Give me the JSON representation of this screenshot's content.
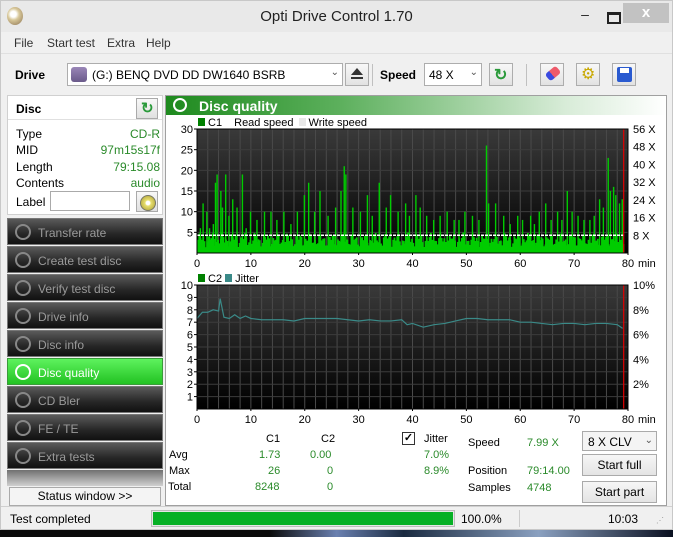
{
  "window": {
    "title": "Opti Drive Control 1.70",
    "minimize": "–",
    "close": "x"
  },
  "menu": [
    "File",
    "Start test",
    "Extra",
    "Help"
  ],
  "toolbar": {
    "drive_label": "Drive",
    "drive_value": "(G:)   BENQ DVD DD DW1640 BSRB",
    "speed_label": "Speed",
    "speed_value": "48 X"
  },
  "disc": {
    "title": "Disc",
    "fields": [
      {
        "key": "Type",
        "value": "CD-R"
      },
      {
        "key": "MID",
        "value": "97m15s17f"
      },
      {
        "key": "Length",
        "value": "79:15.08"
      },
      {
        "key": "Contents",
        "value": "audio"
      }
    ],
    "label_key": "Label",
    "label_value": ""
  },
  "nav": [
    {
      "label": "Transfer rate",
      "active": false
    },
    {
      "label": "Create test disc",
      "active": false
    },
    {
      "label": "Verify test disc",
      "active": false
    },
    {
      "label": "Drive info",
      "active": false
    },
    {
      "label": "Disc info",
      "active": false
    },
    {
      "label": "Disc quality",
      "active": true
    },
    {
      "label": "CD Bler",
      "active": false
    },
    {
      "label": "FE / TE",
      "active": false
    },
    {
      "label": "Extra tests",
      "active": false
    }
  ],
  "status_window_button": "Status window >>",
  "panel_title": "Disc quality",
  "chart_data": [
    {
      "type": "bar",
      "title": "C1",
      "legend": [
        {
          "name": "C1",
          "color": "#008000"
        },
        {
          "name": "Read speed",
          "color": "#ffffff"
        },
        {
          "name": "Write speed",
          "color": "#e8e8e8"
        }
      ],
      "xlabel": "min",
      "x_ticks": [
        0,
        10,
        20,
        30,
        40,
        50,
        60,
        70,
        80
      ],
      "xlim": [
        0,
        80
      ],
      "y_ticks": [
        5,
        10,
        15,
        20,
        25,
        30
      ],
      "ylim": [
        0,
        30
      ],
      "y2_ticks": [
        "8 X",
        "16 X",
        "24 X",
        "32 X",
        "40 X",
        "48 X",
        "56 X"
      ],
      "y2lim": [
        0,
        56
      ],
      "read_speed_x": 8,
      "end_marker_min": 79.2,
      "series_color": "#00cc00",
      "c1_peaks": [
        {
          "x": 0.5,
          "y": 6
        },
        {
          "x": 1,
          "y": 12
        },
        {
          "x": 1.7,
          "y": 10
        },
        {
          "x": 2.2,
          "y": 6
        },
        {
          "x": 2.9,
          "y": 7
        },
        {
          "x": 3.3,
          "y": 17
        },
        {
          "x": 3.6,
          "y": 19
        },
        {
          "x": 4.3,
          "y": 15
        },
        {
          "x": 4.6,
          "y": 11
        },
        {
          "x": 5.2,
          "y": 19
        },
        {
          "x": 5.8,
          "y": 9
        },
        {
          "x": 6.5,
          "y": 13
        },
        {
          "x": 7.3,
          "y": 11
        },
        {
          "x": 8.3,
          "y": 19
        },
        {
          "x": 9,
          "y": 6
        },
        {
          "x": 9.8,
          "y": 10
        },
        {
          "x": 11,
          "y": 8
        },
        {
          "x": 12.4,
          "y": 10
        },
        {
          "x": 13.6,
          "y": 10
        },
        {
          "x": 14.7,
          "y": 8
        },
        {
          "x": 16,
          "y": 10
        },
        {
          "x": 17.3,
          "y": 7
        },
        {
          "x": 18.5,
          "y": 10
        },
        {
          "x": 19.8,
          "y": 14
        },
        {
          "x": 20.6,
          "y": 17
        },
        {
          "x": 21.7,
          "y": 10
        },
        {
          "x": 22.7,
          "y": 15
        },
        {
          "x": 24.2,
          "y": 9
        },
        {
          "x": 25.6,
          "y": 11
        },
        {
          "x": 26.6,
          "y": 15
        },
        {
          "x": 27.2,
          "y": 21
        },
        {
          "x": 27.5,
          "y": 19
        },
        {
          "x": 28.8,
          "y": 11
        },
        {
          "x": 30.2,
          "y": 10
        },
        {
          "x": 31.5,
          "y": 14
        },
        {
          "x": 32.4,
          "y": 9
        },
        {
          "x": 33.7,
          "y": 17
        },
        {
          "x": 35,
          "y": 11
        },
        {
          "x": 35.8,
          "y": 14
        },
        {
          "x": 37.2,
          "y": 10
        },
        {
          "x": 38.6,
          "y": 12
        },
        {
          "x": 39.3,
          "y": 9
        },
        {
          "x": 40.5,
          "y": 14
        },
        {
          "x": 41.3,
          "y": 11
        },
        {
          "x": 42.5,
          "y": 9
        },
        {
          "x": 43.8,
          "y": 8
        },
        {
          "x": 45,
          "y": 9
        },
        {
          "x": 46.3,
          "y": 10
        },
        {
          "x": 47.6,
          "y": 8
        },
        {
          "x": 48.5,
          "y": 8
        },
        {
          "x": 49.6,
          "y": 10
        },
        {
          "x": 51,
          "y": 9
        },
        {
          "x": 52.2,
          "y": 8
        },
        {
          "x": 53.6,
          "y": 26
        },
        {
          "x": 54,
          "y": 12
        },
        {
          "x": 55.3,
          "y": 12
        },
        {
          "x": 56.8,
          "y": 9
        },
        {
          "x": 58,
          "y": 7
        },
        {
          "x": 59.4,
          "y": 9
        },
        {
          "x": 60.3,
          "y": 8
        },
        {
          "x": 61.8,
          "y": 9
        },
        {
          "x": 62.5,
          "y": 7
        },
        {
          "x": 63.4,
          "y": 10
        },
        {
          "x": 64.6,
          "y": 12
        },
        {
          "x": 65.6,
          "y": 8
        },
        {
          "x": 66.8,
          "y": 10
        },
        {
          "x": 67.6,
          "y": 8
        },
        {
          "x": 68.6,
          "y": 15
        },
        {
          "x": 69.5,
          "y": 10
        },
        {
          "x": 70.6,
          "y": 9
        },
        {
          "x": 71.7,
          "y": 8
        },
        {
          "x": 72.8,
          "y": 8
        },
        {
          "x": 73.6,
          "y": 9
        },
        {
          "x": 74.6,
          "y": 13
        },
        {
          "x": 75.3,
          "y": 11
        },
        {
          "x": 76.2,
          "y": 23
        },
        {
          "x": 76.6,
          "y": 15
        },
        {
          "x": 77.2,
          "y": 16
        },
        {
          "x": 77.6,
          "y": 14
        },
        {
          "x": 78.3,
          "y": 12
        },
        {
          "x": 78.8,
          "y": 13
        }
      ]
    },
    {
      "type": "line",
      "title": "C2 / Jitter",
      "legend": [
        {
          "name": "C2",
          "color": "#008000"
        },
        {
          "name": "Jitter",
          "color": "#3a8a88"
        }
      ],
      "xlabel": "min",
      "x_ticks": [
        0,
        10,
        20,
        30,
        40,
        50,
        60,
        70,
        80
      ],
      "xlim": [
        0,
        80
      ],
      "y_ticks": [
        1,
        2,
        3,
        4,
        5,
        6,
        7,
        8,
        9,
        10
      ],
      "ylim": [
        0,
        10
      ],
      "y2_ticks": [
        "2%",
        "4%",
        "6%",
        "8%",
        "10%"
      ],
      "y2lim": [
        0,
        10
      ],
      "end_marker_min": 79.2,
      "jitter_color": "#3a8a88",
      "jitter": [
        {
          "x": 0,
          "y": 7.3
        },
        {
          "x": 1,
          "y": 7.8
        },
        {
          "x": 2,
          "y": 7.8
        },
        {
          "x": 3,
          "y": 8.0
        },
        {
          "x": 4,
          "y": 7.9
        },
        {
          "x": 4.3,
          "y": 8.9
        },
        {
          "x": 5,
          "y": 7.4
        },
        {
          "x": 6,
          "y": 7.3
        },
        {
          "x": 7,
          "y": 7.6
        },
        {
          "x": 8,
          "y": 7.3
        },
        {
          "x": 9,
          "y": 7.5
        },
        {
          "x": 10,
          "y": 7.3
        },
        {
          "x": 12,
          "y": 7.2
        },
        {
          "x": 14,
          "y": 7.2
        },
        {
          "x": 16,
          "y": 7.2
        },
        {
          "x": 18,
          "y": 7.1
        },
        {
          "x": 20,
          "y": 7.3
        },
        {
          "x": 22,
          "y": 7.3
        },
        {
          "x": 24,
          "y": 7.3
        },
        {
          "x": 26,
          "y": 7.3
        },
        {
          "x": 28,
          "y": 7.2
        },
        {
          "x": 30,
          "y": 7.1
        },
        {
          "x": 32,
          "y": 7.2
        },
        {
          "x": 34,
          "y": 7.1
        },
        {
          "x": 36,
          "y": 7.1
        },
        {
          "x": 38,
          "y": 7.2
        },
        {
          "x": 39,
          "y": 6.8
        },
        {
          "x": 40,
          "y": 6.9
        },
        {
          "x": 42,
          "y": 6.6
        },
        {
          "x": 44,
          "y": 6.8
        },
        {
          "x": 46,
          "y": 6.9
        },
        {
          "x": 48,
          "y": 7.1
        },
        {
          "x": 50,
          "y": 7.3
        },
        {
          "x": 52,
          "y": 7.3
        },
        {
          "x": 54,
          "y": 7.2
        },
        {
          "x": 56,
          "y": 7.2
        },
        {
          "x": 58,
          "y": 7.2
        },
        {
          "x": 60,
          "y": 7.0
        },
        {
          "x": 62,
          "y": 7.0
        },
        {
          "x": 64,
          "y": 6.9
        },
        {
          "x": 66,
          "y": 6.8
        },
        {
          "x": 68,
          "y": 6.9
        },
        {
          "x": 70,
          "y": 6.9
        },
        {
          "x": 72,
          "y": 6.8
        },
        {
          "x": 74,
          "y": 6.9
        },
        {
          "x": 76,
          "y": 6.9
        },
        {
          "x": 78,
          "y": 6.8
        },
        {
          "x": 79,
          "y": 6.5
        }
      ]
    }
  ],
  "stats": {
    "col_c1": "C1",
    "col_c2": "C2",
    "jitter_label": "Jitter",
    "jitter_checked": true,
    "rows": [
      {
        "label": "Avg",
        "c1": "1.73",
        "c2": "0.00",
        "jitter": "7.0%"
      },
      {
        "label": "Max",
        "c1": "26",
        "c2": "0",
        "jitter": "8.9%"
      },
      {
        "label": "Total",
        "c1": "8248",
        "c2": "0",
        "jitter": ""
      }
    ],
    "speed_label": "Speed",
    "speed_value": "7.99 X",
    "position_label": "Position",
    "position_value": "79:14.00",
    "samples_label": "Samples",
    "samples_value": "4748"
  },
  "controls": {
    "clv_value": "8 X CLV",
    "start_full": "Start full",
    "start_part": "Start part"
  },
  "statusbar": {
    "text": "Test completed",
    "progress": 100.0,
    "progress_text": "100.0%",
    "time": "10:03"
  }
}
